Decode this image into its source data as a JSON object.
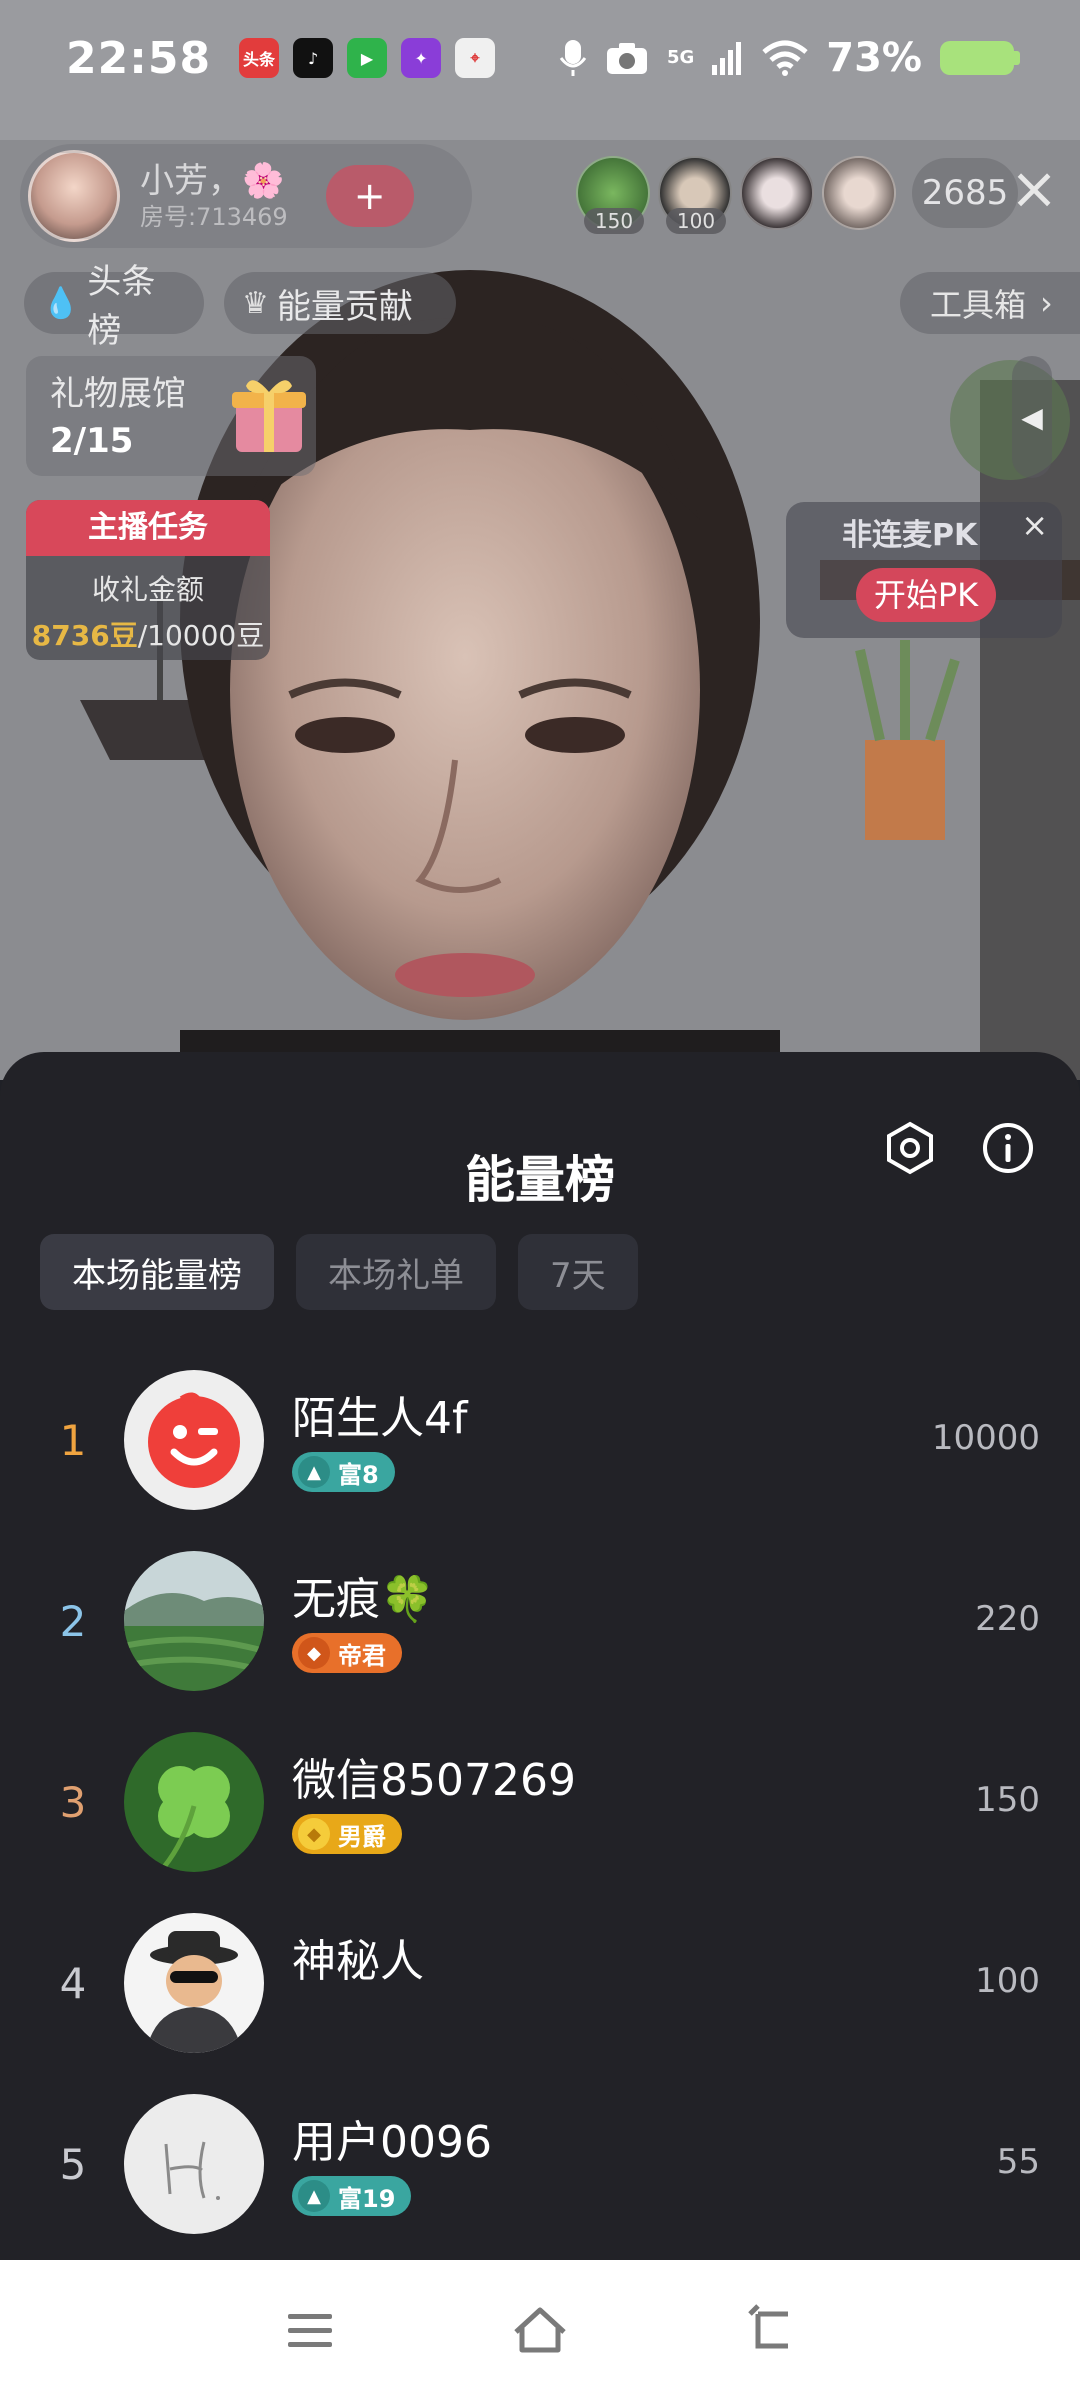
{
  "status_bar": {
    "time": "22:58",
    "network": "5G",
    "battery_percent": "73%",
    "app_icons": [
      {
        "name": "toutiao-icon",
        "glyph": "头条",
        "color": "#e23c3c"
      },
      {
        "name": "tiktok-icon",
        "glyph": "♪",
        "color": "#111111"
      },
      {
        "name": "video-player-icon",
        "glyph": "▶",
        "color": "#2fb34b"
      },
      {
        "name": "game-app-icon",
        "glyph": "✦",
        "color": "#8a3dd8"
      },
      {
        "name": "map-app-icon",
        "glyph": "⌖",
        "color": "#f0f0f0"
      }
    ]
  },
  "host": {
    "name": "小芳，🌸",
    "room": "房号:713469",
    "follow_symbol": "+"
  },
  "viewers": {
    "avatars": [
      {
        "name": "viewer-avatar-clover",
        "score": "150",
        "color": "#4a8a3a"
      },
      {
        "name": "viewer-avatar-hat",
        "score": "100",
        "color": "#3b3b40"
      },
      {
        "name": "viewer-avatar-girl",
        "score": "",
        "color": "#d7d3d8"
      },
      {
        "name": "viewer-avatar-glasses",
        "score": "",
        "color": "#c9c3c0"
      }
    ],
    "count": "2685"
  },
  "overlay": {
    "headlines_label": "头条榜",
    "energy_contribution_label": "能量贡献",
    "toolbox_label": "工具箱",
    "gift_hall_label": "礼物展馆",
    "gift_hall_count": "2/15",
    "task_title": "主播任务",
    "task_subtitle": "收礼金额",
    "task_current": "8736豆",
    "task_target": "/10000豆",
    "pk_title": "非连麦PK",
    "pk_button": "开始PK"
  },
  "sheet": {
    "title": "能量榜",
    "tabs": [
      {
        "label": "本场能量榜",
        "active": true
      },
      {
        "label": "本场礼单",
        "active": false
      },
      {
        "label": "7天",
        "active": false
      }
    ],
    "ranking": [
      {
        "rank": "1",
        "rank_color": "#f0a440",
        "name": "陌生人4f",
        "badge": "富8",
        "badge_color": "#3aa6a0",
        "value": "10000",
        "avatar_type": "red-face"
      },
      {
        "rank": "2",
        "rank_color": "#8cc4e8",
        "name": "无痕🍀",
        "badge": "帝君",
        "badge_color": "#e8702a",
        "value": "220",
        "avatar_type": "landscape"
      },
      {
        "rank": "3",
        "rank_color": "#e0a070",
        "name": "微信8507269",
        "badge": "男爵",
        "badge_color": "#e8a818",
        "value": "150",
        "avatar_type": "clover"
      },
      {
        "rank": "4",
        "rank_color": "#c9cad0",
        "name": "神秘人",
        "badge": "",
        "badge_color": "",
        "value": "100",
        "avatar_type": "mystery"
      },
      {
        "rank": "5",
        "rank_color": "#c9cad0",
        "name": "用户0096",
        "badge": "富19",
        "badge_color": "#3aa6a0",
        "value": "55",
        "avatar_type": "handwriting"
      }
    ]
  }
}
